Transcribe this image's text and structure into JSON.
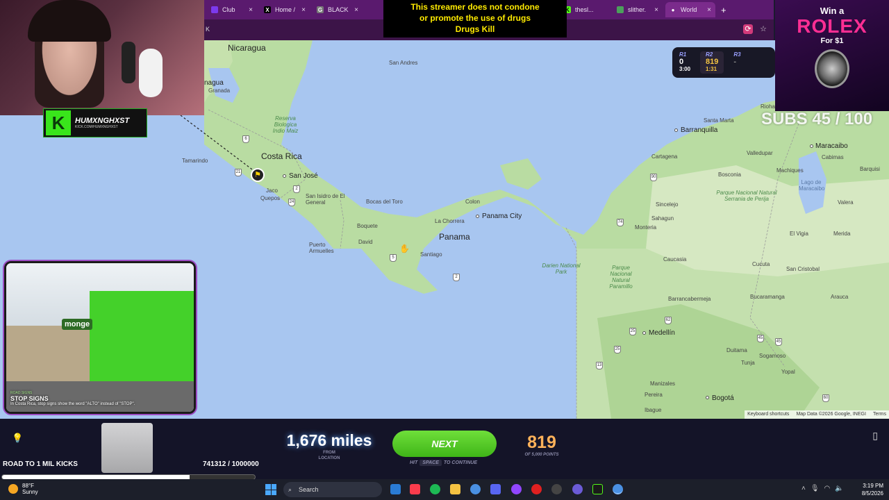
{
  "browser": {
    "tabs": [
      {
        "label": "Club",
        "color": "#7c3aed",
        "icon": "C"
      },
      {
        "label": "Home /",
        "color": "#000000",
        "icon": "X"
      },
      {
        "label": "BLACK",
        "color": "#888888",
        "icon": "G"
      },
      {
        "label": "thesl...",
        "color": "#53fc18",
        "icon": "K"
      },
      {
        "label": "slither.",
        "color": "#4c9f5c",
        "icon": "s"
      },
      {
        "label": "World",
        "color": "#ffffff",
        "icon": "pin"
      }
    ],
    "new_tab": "+",
    "close": "×",
    "url_fragment": "K"
  },
  "disclaimer": {
    "line1": "This streamer does not condone",
    "line2": "or promote the use of drugs",
    "line3": "Drugs Kill"
  },
  "rounds": [
    {
      "label": "R1",
      "score": "0",
      "time": "3:00"
    },
    {
      "label": "R2",
      "score": "819",
      "time": "1:31"
    },
    {
      "label": "R3",
      "score": "-",
      "time": ""
    }
  ],
  "streamer": {
    "name": "HUMXNGHXST",
    "link": "KICK.COM/HUMXNGHXST",
    "logo_letter": "K"
  },
  "street_view": {
    "tag": "ROAD SIGNS",
    "title": "STOP SIGNS",
    "description": "In Costa Rica, stop signs show the word \"ALTO\" instead of \"STOP\".",
    "brand": "monge"
  },
  "ad": {
    "line1": "Win a",
    "brand": "ROLEX",
    "price": "For $1"
  },
  "subs": "SUBS 45 / 100",
  "map": {
    "labels_big": [
      {
        "text": "Nicaragua"
      },
      {
        "text": "Costa Rica"
      },
      {
        "text": "Panama"
      },
      {
        "text": "San José"
      },
      {
        "text": "Panama City"
      },
      {
        "text": "Medellín"
      },
      {
        "text": "Barranquilla"
      },
      {
        "text": "Maracaibo"
      },
      {
        "text": "Bogotá"
      }
    ],
    "labels_small": [
      "San Andres",
      "nagua",
      "Granada",
      "Tamarindo",
      "Jaco",
      "Quepos",
      "San Isidro de El General",
      "Bocas del Toro",
      "Colon",
      "La Chorrera",
      "Boquete",
      "David",
      "Puerto Armuelles",
      "Santiago",
      "Santa Marta",
      "Cartagena",
      "Valledupar",
      "Sincelejo",
      "Monteria",
      "Caucasia",
      "Barrancabermeja",
      "Bucaramanga",
      "Cucuta",
      "San Cristobal",
      "Merida",
      "Valera",
      "Barquisi",
      "Riohacha",
      "Cabimas",
      "Machiques",
      "Bosconia",
      "Sahagun",
      "El Vigia",
      "Tunja",
      "Sogamoso",
      "Yopal",
      "Duitama",
      "Pereira",
      "Manizales",
      "Ibague",
      "Arauca",
      "Lago de Maracaibo"
    ],
    "labels_green": [
      "Reserva Biologica Indio Maiz",
      "Darien National Park",
      "Parque Nacional Natural Paramillo",
      "Parque Nacional Natural Serrania de Perija"
    ],
    "shields": [
      "6",
      "21",
      "2",
      "24",
      "5",
      "2",
      "90",
      "74",
      "25",
      "62",
      "45",
      "45",
      "60",
      "13",
      "25"
    ],
    "footer": [
      "Keyboard shortcuts",
      "Map Data ©2026 Google, INEGI",
      "Terms"
    ]
  },
  "game": {
    "distance": "1,676 miles",
    "distance_sub": "FROM LOCATION",
    "next_label": "NEXT",
    "hint_pre": "HIT",
    "hint_key": "SPACE",
    "hint_post": "TO CONTINUE",
    "points": "819",
    "points_sub": "OF 5,000 POINTS",
    "goal_label": "ROAD TO 1 MIL KICKS",
    "goal_value": "741312 / 1000000",
    "goal_fraction": 0.741312
  },
  "taskbar": {
    "weather_temp": "88°F",
    "weather_cond": "Sunny",
    "search": "Search",
    "time": "3:19 PM",
    "date": "8/5/2026"
  },
  "colors": {
    "accent_purple": "#7b2b8c",
    "next_green": "#4cc420",
    "points_orange": "#ffb25a",
    "rolex_pink": "#ff2e93"
  }
}
